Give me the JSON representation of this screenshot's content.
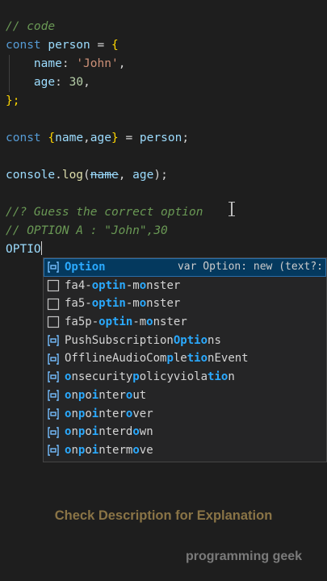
{
  "code": {
    "comment_code": "// code",
    "kw_const": "const",
    "person": "person",
    "eq": "=",
    "open_brace": "{",
    "close_brace": "};",
    "name_key": "name",
    "colon": ":",
    "name_val": "'John'",
    "comma": ",",
    "age_key": "age",
    "age_val": "30",
    "destructure_open": "{",
    "destructure_name": "name",
    "destructure_comma": ",",
    "destructure_age": "age",
    "destructure_close": "}",
    "semicolon": ";",
    "console": "console",
    "dot": ".",
    "log": "log",
    "paren_open": "(",
    "log_name": "name",
    "log_comma": ", ",
    "log_age": "age",
    "paren_close": ");",
    "comment_guess": "//? Guess the correct option",
    "comment_option_a": "// OPTION A : \"John\",30",
    "typed_text": "OPTIO"
  },
  "suggestions": [
    {
      "icon": "variable-icon",
      "parts": [
        {
          "t": "Option",
          "h": true
        }
      ],
      "detail": "var Option: new (text?:"
    },
    {
      "icon": "text-icon",
      "parts": [
        {
          "t": "fa4-",
          "h": false
        },
        {
          "t": "optin",
          "h": true
        },
        {
          "t": "-m",
          "h": false
        },
        {
          "t": "o",
          "h": true
        },
        {
          "t": "nster",
          "h": false
        }
      ],
      "detail": ""
    },
    {
      "icon": "text-icon",
      "parts": [
        {
          "t": "fa5-",
          "h": false
        },
        {
          "t": "optin",
          "h": true
        },
        {
          "t": "-m",
          "h": false
        },
        {
          "t": "o",
          "h": true
        },
        {
          "t": "nster",
          "h": false
        }
      ],
      "detail": ""
    },
    {
      "icon": "text-icon",
      "parts": [
        {
          "t": "fa5p-",
          "h": false
        },
        {
          "t": "optin",
          "h": true
        },
        {
          "t": "-m",
          "h": false
        },
        {
          "t": "o",
          "h": true
        },
        {
          "t": "nster",
          "h": false
        }
      ],
      "detail": ""
    },
    {
      "icon": "variable-icon",
      "parts": [
        {
          "t": "PushSubscription",
          "h": false
        },
        {
          "t": "Optio",
          "h": true
        },
        {
          "t": "ns",
          "h": false
        }
      ],
      "detail": ""
    },
    {
      "icon": "variable-icon",
      "parts": [
        {
          "t": "OfflineAudioCom",
          "h": false
        },
        {
          "t": "p",
          "h": true
        },
        {
          "t": "le",
          "h": false
        },
        {
          "t": "tio",
          "h": true
        },
        {
          "t": "nEvent",
          "h": false
        }
      ],
      "detail": ""
    },
    {
      "icon": "variable-icon",
      "parts": [
        {
          "t": "o",
          "h": true
        },
        {
          "t": "nsecurity",
          "h": false
        },
        {
          "t": "p",
          "h": true
        },
        {
          "t": "olicyviola",
          "h": false
        },
        {
          "t": "tio",
          "h": true
        },
        {
          "t": "n",
          "h": false
        }
      ],
      "detail": ""
    },
    {
      "icon": "variable-icon",
      "parts": [
        {
          "t": "o",
          "h": true
        },
        {
          "t": "n",
          "h": false
        },
        {
          "t": "p",
          "h": true
        },
        {
          "t": "o",
          "h": false
        },
        {
          "t": "i",
          "h": true
        },
        {
          "t": "nter",
          "h": false
        },
        {
          "t": "o",
          "h": true
        },
        {
          "t": "ut",
          "h": false
        }
      ],
      "detail": ""
    },
    {
      "icon": "variable-icon",
      "parts": [
        {
          "t": "o",
          "h": true
        },
        {
          "t": "n",
          "h": false
        },
        {
          "t": "p",
          "h": true
        },
        {
          "t": "o",
          "h": false
        },
        {
          "t": "i",
          "h": true
        },
        {
          "t": "nter",
          "h": false
        },
        {
          "t": "o",
          "h": true
        },
        {
          "t": "ver",
          "h": false
        }
      ],
      "detail": ""
    },
    {
      "icon": "variable-icon",
      "parts": [
        {
          "t": "o",
          "h": true
        },
        {
          "t": "n",
          "h": false
        },
        {
          "t": "p",
          "h": true
        },
        {
          "t": "o",
          "h": false
        },
        {
          "t": "i",
          "h": true
        },
        {
          "t": "nterd",
          "h": false
        },
        {
          "t": "o",
          "h": true
        },
        {
          "t": "wn",
          "h": false
        }
      ],
      "detail": ""
    },
    {
      "icon": "variable-icon",
      "parts": [
        {
          "t": "o",
          "h": true
        },
        {
          "t": "n",
          "h": false
        },
        {
          "t": "p",
          "h": true
        },
        {
          "t": "o",
          "h": false
        },
        {
          "t": "i",
          "h": true
        },
        {
          "t": "nterm",
          "h": false
        },
        {
          "t": "o",
          "h": true
        },
        {
          "t": "ve",
          "h": false
        }
      ],
      "detail": ""
    }
  ],
  "caption": "Check Description for Explanation",
  "watermark": "programming geek",
  "colors": {
    "background": "#1e1e1e",
    "highlight": "#2aaaff",
    "selected_row": "#04395e",
    "caption": "#8a7446"
  }
}
